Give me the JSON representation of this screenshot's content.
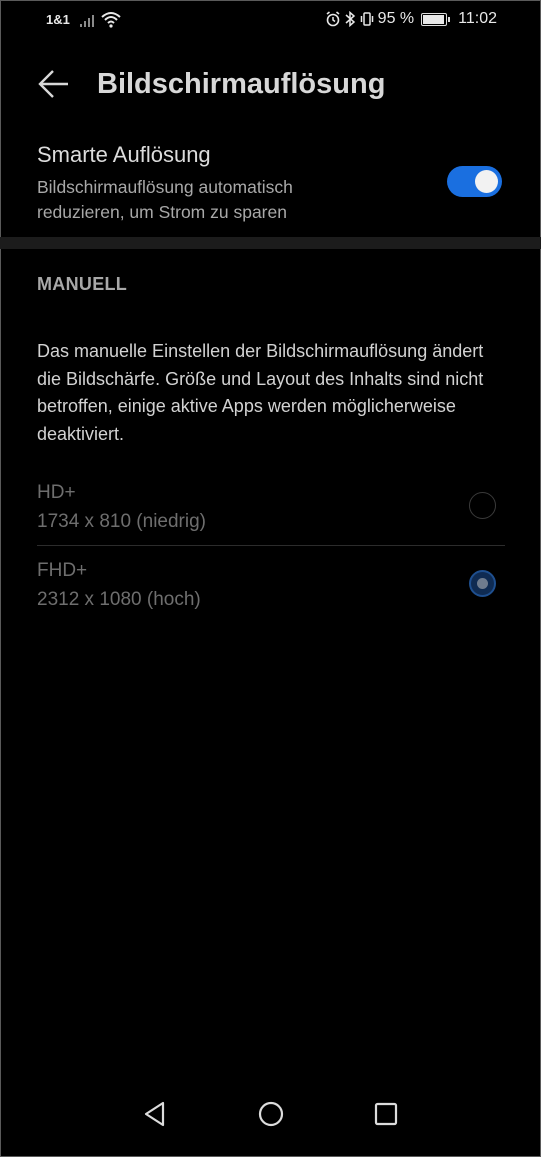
{
  "status_bar": {
    "carrier": "1&1",
    "battery_percent": "95 %",
    "battery_level": 0.95,
    "time": "11:02",
    "icons": [
      "signal-icon",
      "wifi-icon",
      "alarm-icon",
      "bluetooth-icon",
      "vibrate-icon",
      "battery-icon"
    ]
  },
  "header": {
    "title": "Bildschirmauflösung",
    "back_icon": "arrow-left-icon"
  },
  "smart_resolution": {
    "title": "Smarte Auflösung",
    "description": "Bildschirmauflösung automatisch reduzieren, um Strom zu sparen",
    "enabled": true,
    "accent_color": "#1a6fe0"
  },
  "manual": {
    "section_label": "MANUELL",
    "description": "Das manuelle Einstellen der Bildschirmauflösung ändert die Bildschärfe. Größe und Layout des Inhalts sind nicht betroffen, einige aktive Apps werden möglicherweise deaktiviert.",
    "options": [
      {
        "name": "HD+",
        "detail": "1734 x 810 (niedrig)",
        "selected": false
      },
      {
        "name": "FHD+",
        "detail": "2312 x 1080 (hoch)",
        "selected": true
      }
    ]
  },
  "nav_bar": {
    "icons": [
      "back-triangle-icon",
      "home-circle-icon",
      "recents-square-icon"
    ]
  }
}
